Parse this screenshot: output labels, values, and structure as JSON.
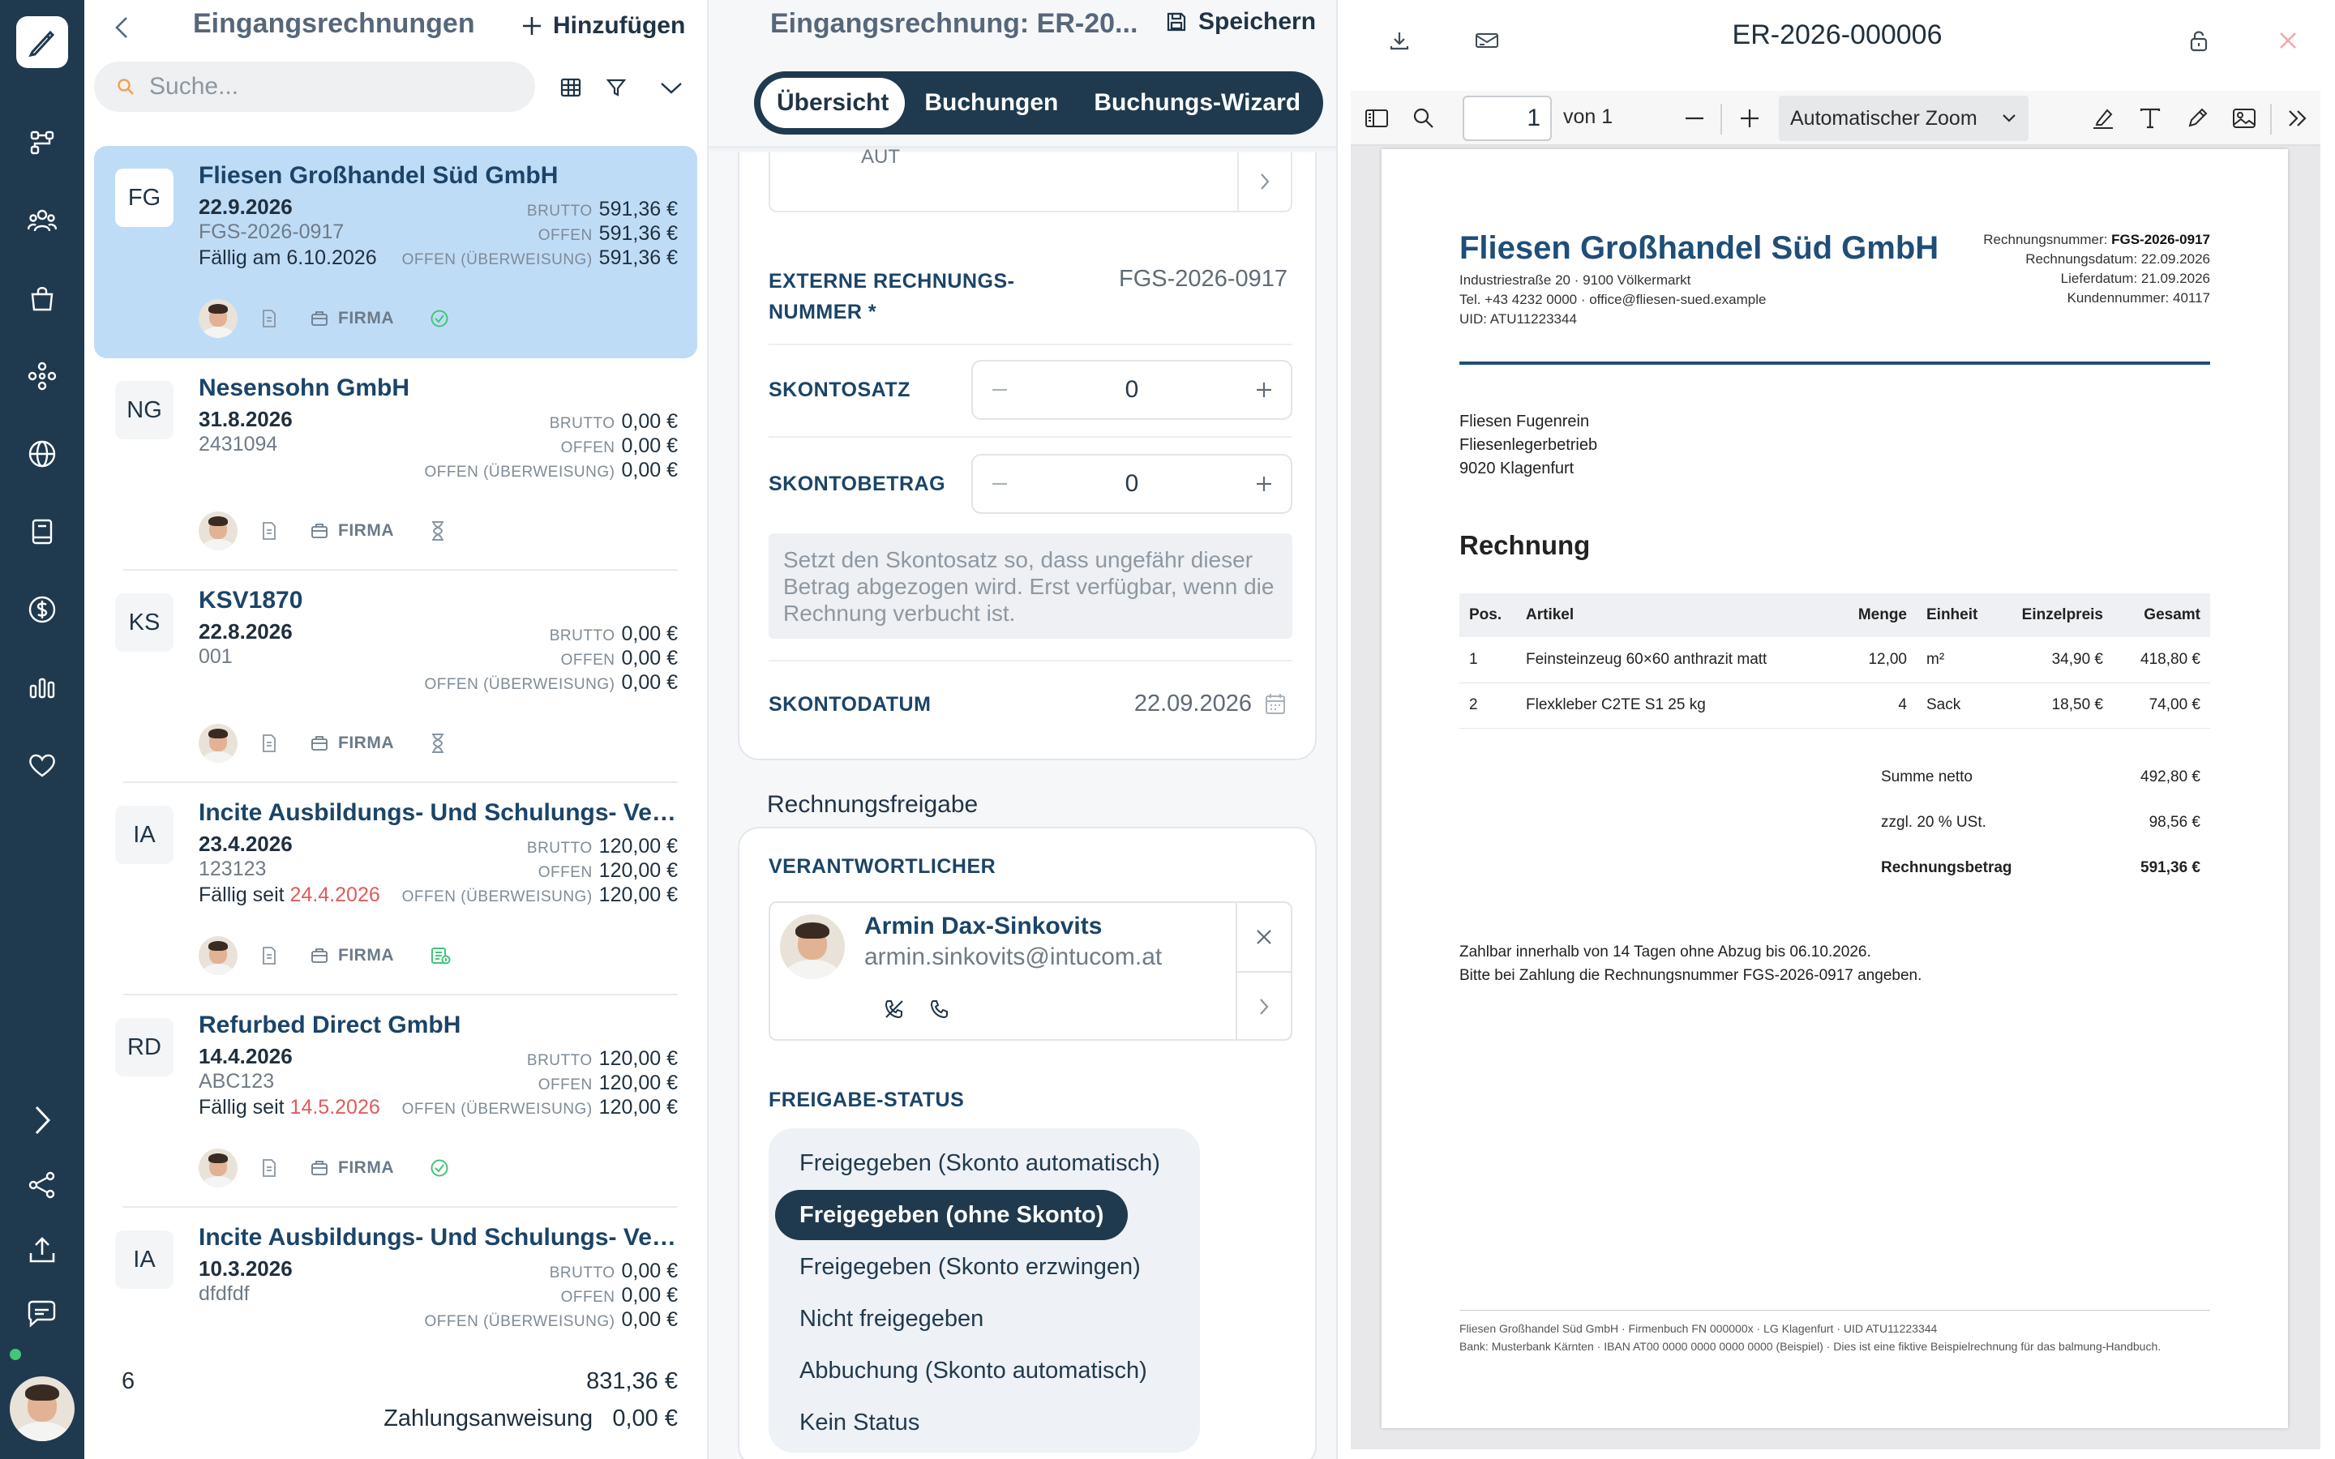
{
  "colors": {
    "navy": "#1f3a4e",
    "selected": "#bfdcf7",
    "heading": "#1b4468",
    "overdue": "#e05b5b",
    "ok": "#45c47a"
  },
  "rail": {
    "icons": [
      "logo-pen-icon",
      "workflow-icon",
      "users-icon",
      "shopping-bag-icon",
      "network-icon",
      "globe-icon",
      "book-icon",
      "dollar-icon",
      "bar-chart-icon",
      "heart-icon",
      "chevron-right-icon",
      "share-icon",
      "upload-icon",
      "chat-icon"
    ]
  },
  "list": {
    "title": "Eingangsrechnungen",
    "add_label": "Hinzufügen",
    "search_placeholder": "Suche...",
    "brutto_label": "BRUTTO",
    "offen_label": "OFFEN",
    "payment_label": "OFFEN (ÜBERWEISUNG)",
    "firma_label": "FIRMA",
    "due_prefix": "Fällig am",
    "overdue_prefix": "Fällig seit",
    "invoices": [
      {
        "initials": "FG",
        "name": "Fliesen Großhandel Süd GmbH",
        "date": "22.9.2026",
        "ref": "FGS-2026-0917",
        "due": "6.10.2026",
        "due_type": "am",
        "brutto": "591,36 €",
        "offen": "591,36 €",
        "payment": "591,36 €",
        "status_icon": "check-circle-icon"
      },
      {
        "initials": "NG",
        "name": "Nesensohn GmbH",
        "date": "31.8.2026",
        "ref": "2431094",
        "due": "",
        "due_type": "",
        "brutto": "0,00 €",
        "offen": "0,00 €",
        "payment": "0,00 €",
        "status_icon": "hourglass-icon"
      },
      {
        "initials": "KS",
        "name": "KSV1870",
        "date": "22.8.2026",
        "ref": "001",
        "due": "",
        "due_type": "",
        "brutto": "0,00 €",
        "offen": "0,00 €",
        "payment": "0,00 €",
        "status_icon": "hourglass-icon"
      },
      {
        "initials": "IA",
        "name": "Incite Ausbildungs- Und Schulungs- Verwaltungs GmbH",
        "date": "23.4.2026",
        "ref": "123123",
        "due": "24.4.2026",
        "due_type": "seit",
        "brutto": "120,00 €",
        "offen": "120,00 €",
        "payment": "120,00 €",
        "status_icon": "money-icon"
      },
      {
        "initials": "RD",
        "name": "Refurbed Direct GmbH",
        "date": "14.4.2026",
        "ref": "ABC123",
        "due": "14.5.2026",
        "due_type": "seit",
        "brutto": "120,00 €",
        "offen": "120,00 €",
        "payment": "120,00 €",
        "status_icon": "check-circle-icon"
      },
      {
        "initials": "IA",
        "name": "Incite Ausbildungs- Und Schulungs- Verwaltungs GmbH",
        "date": "10.3.2026",
        "ref": "dfdfdf",
        "due": "",
        "due_type": "",
        "brutto": "0,00 €",
        "offen": "0,00 €",
        "payment": "0,00 €",
        "status_icon": "check-circle-icon"
      }
    ],
    "totals": {
      "count": "6",
      "sum": "831,36 €",
      "zahlung_label": "Zahlungsanweisung",
      "zahlung_value": "0,00 €"
    }
  },
  "detail": {
    "title": "Eingangsrechnung: ER-20...",
    "save_label": "Speichern",
    "tabs": [
      "Übersicht",
      "Buchungen",
      "Buchungs-Wizard"
    ],
    "aut_value": "AUT",
    "ext_nr_label_1": "EXTERNE RECHNUNGS-",
    "ext_nr_label_2": "NUMMER *",
    "ext_nr_value": "FGS-2026-0917",
    "skontosatz_label": "SKONTOSATZ",
    "skontosatz_value": "0",
    "skontobetrag_label": "SKONTOBETRAG",
    "skontobetrag_value": "0",
    "hint": "Setzt den Skontosatz so, dass ungefähr dieser Betrag abgezogen wird. Erst verfügbar, wenn die Rechnung verbucht ist.",
    "skontodatum_label": "SKONTODATUM",
    "skontodatum_value": "22.09.2026",
    "freigabe_title": "Rechnungsfreigabe",
    "verantwortlicher_label": "VERANTWORTLICHER",
    "person_name": "Armin Dax-Sinkovits",
    "person_email": "armin.sinkovits@intucom.at",
    "status_label": "FREIGABE-STATUS",
    "status_options": [
      "Freigegeben (Skonto automatisch)",
      "Freigegeben (ohne Skonto)",
      "Freigegeben (Skonto erzwingen)",
      "Nicht freigegeben",
      "Abbuchung (Skonto automatisch)",
      "Kein Status"
    ],
    "status_selected": "Freigegeben (ohne Skonto)"
  },
  "pdf": {
    "title": "ER-2026-000006",
    "page_value": "1",
    "page_of": "von 1",
    "zoom": "Automatischer Zoom",
    "doc": {
      "company": "Fliesen Großhandel Süd GmbH",
      "addr_1": "Industriestraße 20 · 9100 Völkermarkt",
      "addr_2": "Tel. +43 4232 0000 · office@fliesen-sued.example",
      "addr_3": "UID: ATU11223344",
      "meta": [
        {
          "label": "Rechnungsnummer:",
          "value": "FGS-2026-0917",
          "bold": true
        },
        {
          "label": "Rechnungsdatum:",
          "value": "22.09.2026",
          "bold": false
        },
        {
          "label": "Lieferdatum:",
          "value": "21.09.2026",
          "bold": false
        },
        {
          "label": "Kundennummer:",
          "value": "40117",
          "bold": false
        }
      ],
      "recipient_1": "Fliesen Fugenrein",
      "recipient_2": "Fliesenlegerbetrieb",
      "recipient_3": "9020 Klagenfurt",
      "heading": "Rechnung",
      "columns": [
        "Pos.",
        "Artikel",
        "Menge",
        "Einheit",
        "Einzelpreis",
        "Gesamt"
      ],
      "rows": [
        [
          "1",
          "Feinsteinzeug 60×60 anthrazit matt",
          "12,00",
          "m²",
          "34,90 €",
          "418,80 €"
        ],
        [
          "2",
          "Flexkleber C2TE S1 25 kg",
          "4",
          "Sack",
          "18,50 €",
          "74,00 €"
        ]
      ],
      "netto_label": "Summe netto",
      "netto_value": "492,80 €",
      "ust_label": "zzgl. 20 % USt.",
      "ust_value": "98,56 €",
      "total_label": "Rechnungsbetrag",
      "total_value": "591,36 €",
      "pay_1": "Zahlbar innerhalb von 14 Tagen ohne Abzug bis 06.10.2026.",
      "pay_2": "Bitte bei Zahlung die Rechnungsnummer FGS-2026-0917 angeben.",
      "footer_1": "Fliesen Großhandel Süd GmbH · Firmenbuch FN 000000x · LG Klagenfurt · UID ATU11223344",
      "footer_2": "Bank: Musterbank Kärnten · IBAN AT00 0000 0000 0000 0000 (Beispiel) · Dies ist eine fiktive Beispielrechnung für das balmung-Handbuch."
    }
  }
}
